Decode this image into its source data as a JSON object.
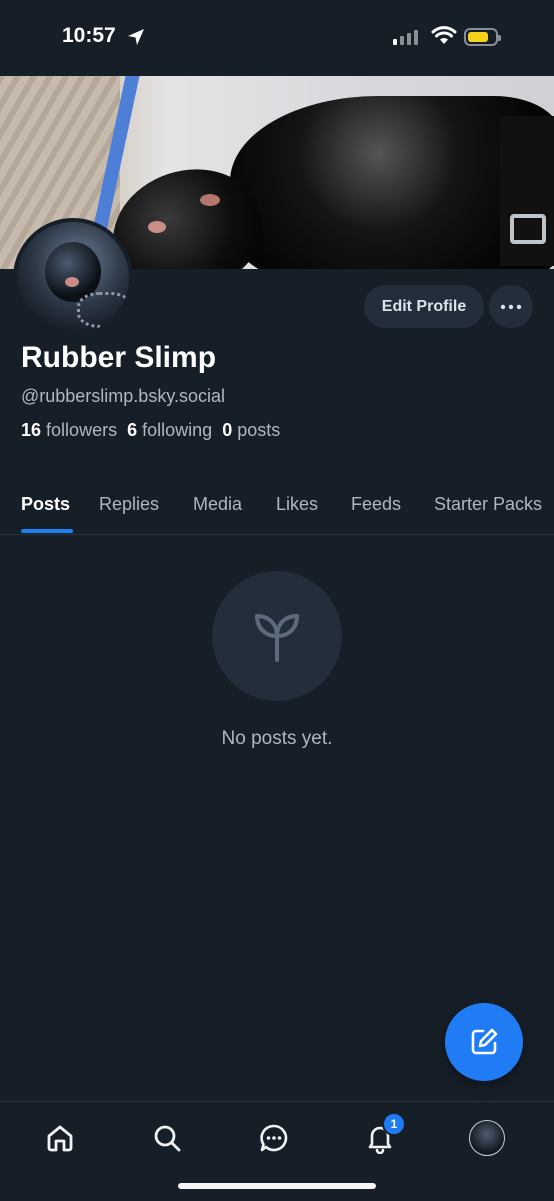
{
  "status_bar": {
    "time": "10:57"
  },
  "profile": {
    "display_name": "Rubber Slimp",
    "handle": "@rubberslimp.bsky.social",
    "followers_count": "16",
    "followers_label": "followers",
    "following_count": "6",
    "following_label": "following",
    "posts_count": "0",
    "posts_label": "posts",
    "edit_button": "Edit Profile"
  },
  "tabs": [
    "Posts",
    "Replies",
    "Media",
    "Likes",
    "Feeds",
    "Starter Packs"
  ],
  "active_tab": "Posts",
  "empty_state": {
    "text": "No posts yet.",
    "icon": "sprout-icon"
  },
  "bottom_nav": {
    "items": [
      "home-icon",
      "search-icon",
      "chat-icon",
      "bell-icon",
      "profile-avatar"
    ],
    "notification_badge": "1"
  },
  "colors": {
    "accent": "#1e81f0",
    "background": "#161e27",
    "surface": "#232e3a",
    "muted_text": "#aeb7c1"
  }
}
